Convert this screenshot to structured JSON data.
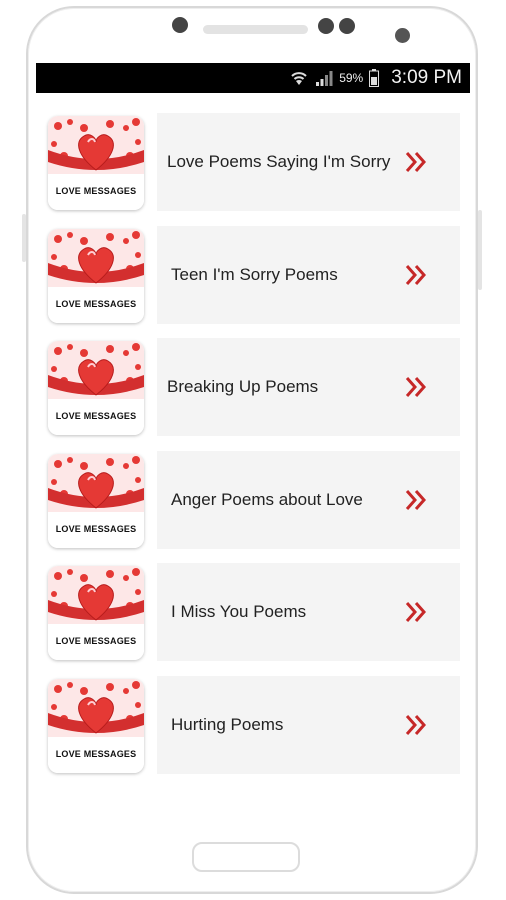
{
  "status_bar": {
    "battery_percent": "59%",
    "time": "3:09 PM",
    "icons": [
      "wifi-icon",
      "signal-icon",
      "battery-icon"
    ]
  },
  "thumbnail_label": "LOVE MESSAGES",
  "colors": {
    "accent": "#c62828",
    "card_bg": "#f4f4f4",
    "status_bar": "#000000"
  },
  "items": [
    {
      "label": "Love Poems Saying I'm Sorry"
    },
    {
      "label": "Teen I'm Sorry Poems"
    },
    {
      "label": "Breaking Up Poems"
    },
    {
      "label": "Anger Poems about Love"
    },
    {
      "label": "I Miss You Poems"
    },
    {
      "label": "Hurting Poems"
    }
  ]
}
